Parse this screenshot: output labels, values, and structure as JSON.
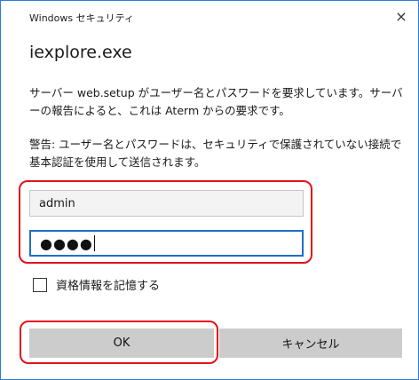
{
  "window": {
    "title": "Windows セキュリティ",
    "close_icon": "×"
  },
  "app_name": "iexplore.exe",
  "message": "サーバー web.setup がユーザー名とパスワードを要求しています。サーバーの報告によると、これは Aterm からの要求です。",
  "warning": "警告: ユーザー名とパスワードは、セキュリティで保護されていない接続で基本認証を使用して送信されます。",
  "credentials": {
    "username": "admin",
    "password_mask": "●●●●"
  },
  "remember": {
    "label": "資格情報を記憶する",
    "checked": false
  },
  "buttons": {
    "ok": "OK",
    "cancel": "キャンセル"
  },
  "colors": {
    "annotation": "#e2131b",
    "focus": "#1f6fc5",
    "window_border": "#2b7cd3"
  }
}
